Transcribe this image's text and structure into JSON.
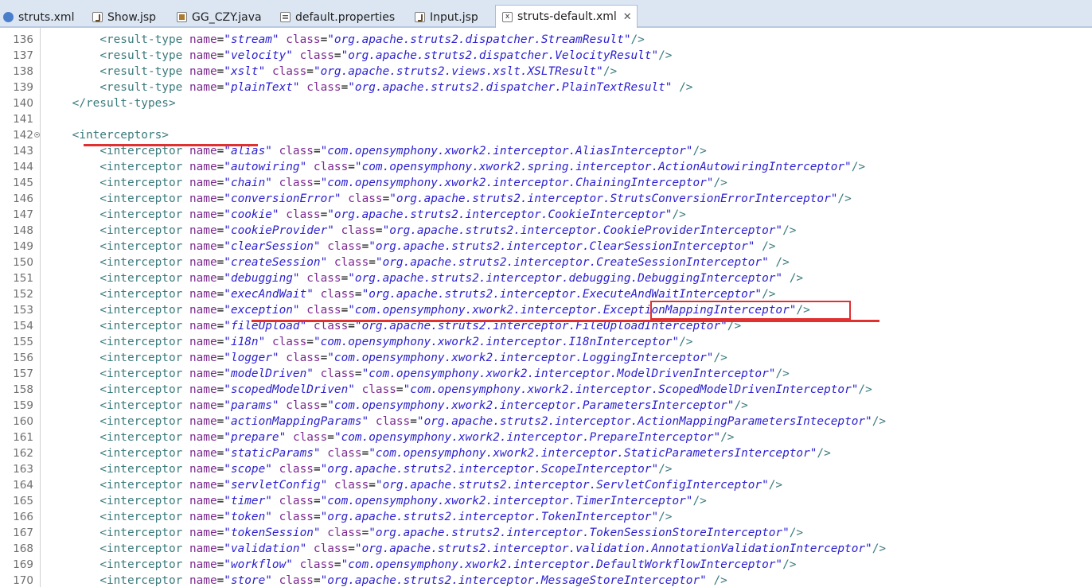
{
  "tabs": [
    {
      "label": "struts.xml",
      "icon": "gear-icon",
      "active": false
    },
    {
      "label": "Show.jsp",
      "icon": "jsp-file-icon",
      "active": false
    },
    {
      "label": "GG_CZY.java",
      "icon": "java-file-icon",
      "active": false
    },
    {
      "label": "default.properties",
      "icon": "properties-file-icon",
      "active": false
    },
    {
      "label": "Input.jsp",
      "icon": "jsp-file-icon",
      "active": false
    },
    {
      "label": "struts-default.xml",
      "icon": "xml-file-icon",
      "active": true
    }
  ],
  "close_glyph": "✕",
  "lines": [
    {
      "n": "136",
      "indent": "        ",
      "el": "result-type",
      "name": "stream",
      "cls": "org.apache.struts2.dispatcher.StreamResult",
      "end": "/>"
    },
    {
      "n": "137",
      "indent": "        ",
      "el": "result-type",
      "name": "velocity",
      "cls": "org.apache.struts2.dispatcher.VelocityResult",
      "end": "/>"
    },
    {
      "n": "138",
      "indent": "        ",
      "el": "result-type",
      "name": "xslt",
      "cls": "org.apache.struts2.views.xslt.XSLTResult",
      "end": "/>"
    },
    {
      "n": "139",
      "indent": "        ",
      "el": "result-type",
      "name": "plainText",
      "cls": "org.apache.struts2.dispatcher.PlainTextResult",
      "end": " />"
    },
    {
      "n": "140",
      "raw": "    </result-types>"
    },
    {
      "n": "141",
      "raw": ""
    },
    {
      "n": "142",
      "raw": "    <interceptors>",
      "fold": true
    },
    {
      "n": "143",
      "indent": "        ",
      "el": "interceptor",
      "name": "alias",
      "cls": "com.opensymphony.xwork2.interceptor.AliasInterceptor",
      "end": "/>"
    },
    {
      "n": "144",
      "indent": "        ",
      "el": "interceptor",
      "name": "autowiring",
      "cls": "com.opensymphony.xwork2.spring.interceptor.ActionAutowiringInterceptor",
      "end": "/>"
    },
    {
      "n": "145",
      "indent": "        ",
      "el": "interceptor",
      "name": "chain",
      "cls": "com.opensymphony.xwork2.interceptor.ChainingInterceptor",
      "end": "/>"
    },
    {
      "n": "146",
      "indent": "        ",
      "el": "interceptor",
      "name": "conversionError",
      "cls": "org.apache.struts2.interceptor.StrutsConversionErrorInterceptor",
      "end": "/>"
    },
    {
      "n": "147",
      "indent": "        ",
      "el": "interceptor",
      "name": "cookie",
      "cls": "org.apache.struts2.interceptor.CookieInterceptor",
      "end": "/>"
    },
    {
      "n": "148",
      "indent": "        ",
      "el": "interceptor",
      "name": "cookieProvider",
      "cls": "org.apache.struts2.interceptor.CookieProviderInterceptor",
      "end": "/>"
    },
    {
      "n": "149",
      "indent": "        ",
      "el": "interceptor",
      "name": "clearSession",
      "cls": "org.apache.struts2.interceptor.ClearSessionInterceptor",
      "end": " />"
    },
    {
      "n": "150",
      "indent": "        ",
      "el": "interceptor",
      "name": "createSession",
      "cls": "org.apache.struts2.interceptor.CreateSessionInterceptor",
      "end": " />"
    },
    {
      "n": "151",
      "indent": "        ",
      "el": "interceptor",
      "name": "debugging",
      "cls": "org.apache.struts2.interceptor.debugging.DebuggingInterceptor",
      "end": " />"
    },
    {
      "n": "152",
      "indent": "        ",
      "el": "interceptor",
      "name": "execAndWait",
      "cls": "org.apache.struts2.interceptor.ExecuteAndWaitInterceptor",
      "end": "/>"
    },
    {
      "n": "153",
      "indent": "        ",
      "el": "interceptor",
      "name": "exception",
      "cls": "com.opensymphony.xwork2.interceptor.ExceptionMappingInterceptor",
      "end": "/>"
    },
    {
      "n": "154",
      "indent": "        ",
      "el": "interceptor",
      "name": "fileUpload",
      "cls": "org.apache.struts2.interceptor.FileUploadInterceptor",
      "end": "/>"
    },
    {
      "n": "155",
      "indent": "        ",
      "el": "interceptor",
      "name": "i18n",
      "cls": "com.opensymphony.xwork2.interceptor.I18nInterceptor",
      "end": "/>"
    },
    {
      "n": "156",
      "indent": "        ",
      "el": "interceptor",
      "name": "logger",
      "cls": "com.opensymphony.xwork2.interceptor.LoggingInterceptor",
      "end": "/>"
    },
    {
      "n": "157",
      "indent": "        ",
      "el": "interceptor",
      "name": "modelDriven",
      "cls": "com.opensymphony.xwork2.interceptor.ModelDrivenInterceptor",
      "end": "/>"
    },
    {
      "n": "158",
      "indent": "        ",
      "el": "interceptor",
      "name": "scopedModelDriven",
      "cls": "com.opensymphony.xwork2.interceptor.ScopedModelDrivenInterceptor",
      "end": "/>"
    },
    {
      "n": "159",
      "indent": "        ",
      "el": "interceptor",
      "name": "params",
      "cls": "com.opensymphony.xwork2.interceptor.ParametersInterceptor",
      "end": "/>"
    },
    {
      "n": "160",
      "indent": "        ",
      "el": "interceptor",
      "name": "actionMappingParams",
      "cls": "org.apache.struts2.interceptor.ActionMappingParametersInteceptor",
      "end": "/>"
    },
    {
      "n": "161",
      "indent": "        ",
      "el": "interceptor",
      "name": "prepare",
      "cls": "com.opensymphony.xwork2.interceptor.PrepareInterceptor",
      "end": "/>"
    },
    {
      "n": "162",
      "indent": "        ",
      "el": "interceptor",
      "name": "staticParams",
      "cls": "com.opensymphony.xwork2.interceptor.StaticParametersInterceptor",
      "end": "/>"
    },
    {
      "n": "163",
      "indent": "        ",
      "el": "interceptor",
      "name": "scope",
      "cls": "org.apache.struts2.interceptor.ScopeInterceptor",
      "end": "/>"
    },
    {
      "n": "164",
      "indent": "        ",
      "el": "interceptor",
      "name": "servletConfig",
      "cls": "org.apache.struts2.interceptor.ServletConfigInterceptor",
      "end": "/>"
    },
    {
      "n": "165",
      "indent": "        ",
      "el": "interceptor",
      "name": "timer",
      "cls": "com.opensymphony.xwork2.interceptor.TimerInterceptor",
      "end": "/>"
    },
    {
      "n": "166",
      "indent": "        ",
      "el": "interceptor",
      "name": "token",
      "cls": "org.apache.struts2.interceptor.TokenInterceptor",
      "end": "/>"
    },
    {
      "n": "167",
      "indent": "        ",
      "el": "interceptor",
      "name": "tokenSession",
      "cls": "org.apache.struts2.interceptor.TokenSessionStoreInterceptor",
      "end": "/>"
    },
    {
      "n": "168",
      "indent": "        ",
      "el": "interceptor",
      "name": "validation",
      "cls": "org.apache.struts2.interceptor.validation.AnnotationValidationInterceptor",
      "end": "/>"
    },
    {
      "n": "169",
      "indent": "        ",
      "el": "interceptor",
      "name": "workflow",
      "cls": "com.opensymphony.xwork2.interceptor.DefaultWorkflowInterceptor",
      "end": "/>"
    },
    {
      "n": "170",
      "indent": "        ",
      "el": "interceptor",
      "name": "store",
      "cls": "org.apache.struts2.interceptor.MessageStoreInterceptor",
      "end": " />"
    }
  ],
  "colors": {
    "tag": "#3b7a7c",
    "attr_name": "#7b2a8f",
    "attr_value": "#2a1fd0",
    "annotation": "#e03030"
  }
}
